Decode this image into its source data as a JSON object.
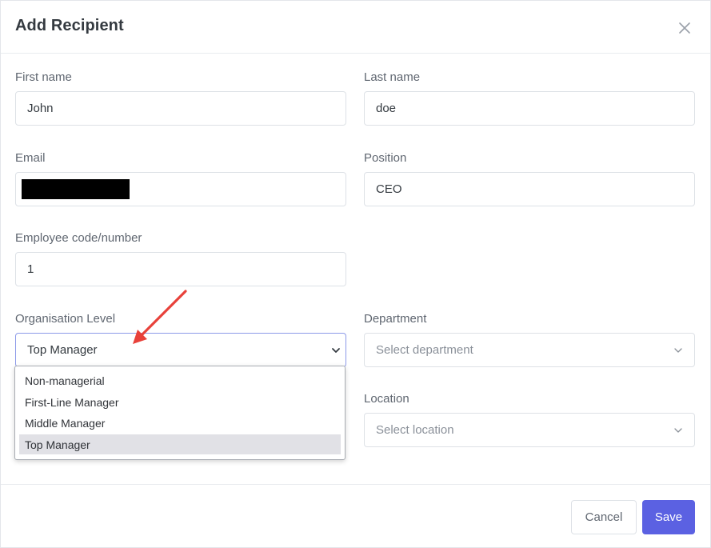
{
  "modal": {
    "title": "Add Recipient",
    "close_icon": "close-icon"
  },
  "form": {
    "first_name": {
      "label": "First name",
      "value": "John"
    },
    "last_name": {
      "label": "Last name",
      "value": "doe"
    },
    "email": {
      "label": "Email",
      "value": ""
    },
    "position": {
      "label": "Position",
      "value": "CEO"
    },
    "employee_code": {
      "label": "Employee code/number",
      "value": "1"
    },
    "organisation_level": {
      "label": "Organisation Level",
      "value": "Top Manager",
      "options": [
        "Non-managerial",
        "First-Line Manager",
        "Middle Manager",
        "Top Manager"
      ],
      "selected_index": 3
    },
    "department": {
      "label": "Department",
      "placeholder": "Select department"
    },
    "location": {
      "label": "Location",
      "placeholder": "Select location"
    }
  },
  "footer": {
    "cancel_label": "Cancel",
    "save_label": "Save"
  },
  "colors": {
    "primary": "#5b61e2",
    "annotation_arrow": "#e8413a",
    "selected_option_bg": "#e1e1e6"
  }
}
